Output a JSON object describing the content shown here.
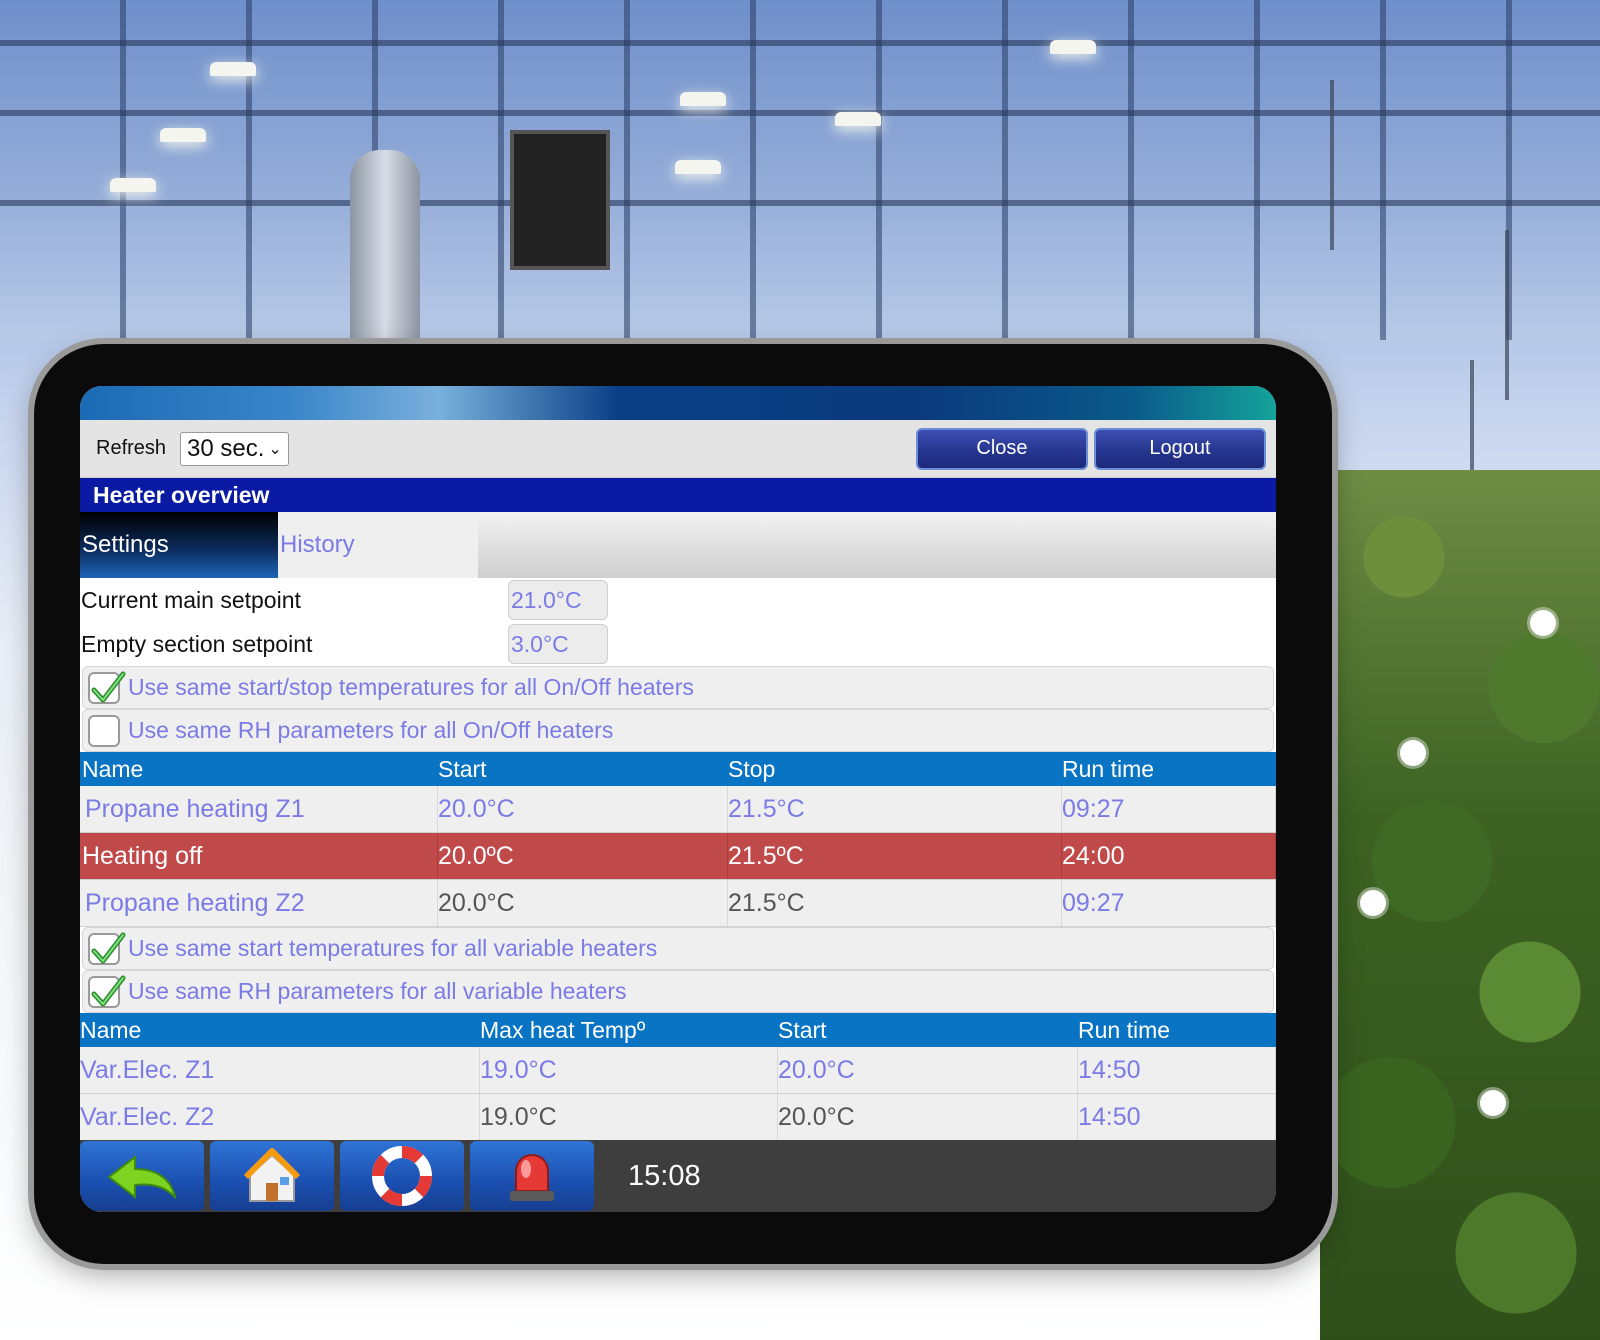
{
  "toolbar": {
    "refresh_label": "Refresh",
    "refresh_value": "30 sec.",
    "close_label": "Close",
    "logout_label": "Logout"
  },
  "page": {
    "title": "Heater overview"
  },
  "tabs": [
    {
      "label": "Settings",
      "active": true
    },
    {
      "label": "History",
      "active": false
    }
  ],
  "setpoints": [
    {
      "label": "Current main setpoint",
      "value": "21.0°C"
    },
    {
      "label": "Empty section setpoint",
      "value": "3.0°C"
    }
  ],
  "onoff_options": [
    {
      "label": "Use same start/stop temperatures for all On/Off heaters",
      "checked": true
    },
    {
      "label": "Use same RH parameters for all On/Off heaters",
      "checked": false
    }
  ],
  "onoff_table": {
    "headers": [
      "Name",
      "Start",
      "Stop",
      "Run time"
    ],
    "rows": [
      {
        "name": "Propane heating Z1",
        "start": "20.0°C",
        "stop": "21.5°C",
        "run_time": "09:27"
      },
      {
        "name": "Heating off",
        "start": "20.0ºC",
        "stop": "21.5ºC",
        "run_time": "24:00",
        "alarm": true
      },
      {
        "name": "Propane heating Z2",
        "start": "20.0°C",
        "stop": "21.5°C",
        "run_time": "09:27"
      }
    ]
  },
  "variable_options": [
    {
      "label": "Use same start temperatures for all variable heaters",
      "checked": true
    },
    {
      "label": "Use same RH parameters for all variable heaters",
      "checked": true
    }
  ],
  "variable_table": {
    "headers": [
      "Name",
      "Max heat Tempº",
      "Start",
      "Run time"
    ],
    "rows": [
      {
        "name": "Var.Elec. Z1",
        "max_heat": "19.0°C",
        "start": "20.0°C",
        "run_time": "14:50"
      },
      {
        "name": "Var.Elec. Z2",
        "max_heat": "19.0°C",
        "start": "20.0°C",
        "run_time": "14:50"
      }
    ]
  },
  "footer": {
    "buttons": [
      "back-arrow-icon",
      "home-icon",
      "lifebuoy-icon",
      "alarm-beacon-icon"
    ],
    "clock": "15:08"
  },
  "colors": {
    "title_bar": "#0a1aa3",
    "table_header": "#0a74c4",
    "alarm_row": "#c0494a",
    "value_text": "#7b7be6"
  }
}
